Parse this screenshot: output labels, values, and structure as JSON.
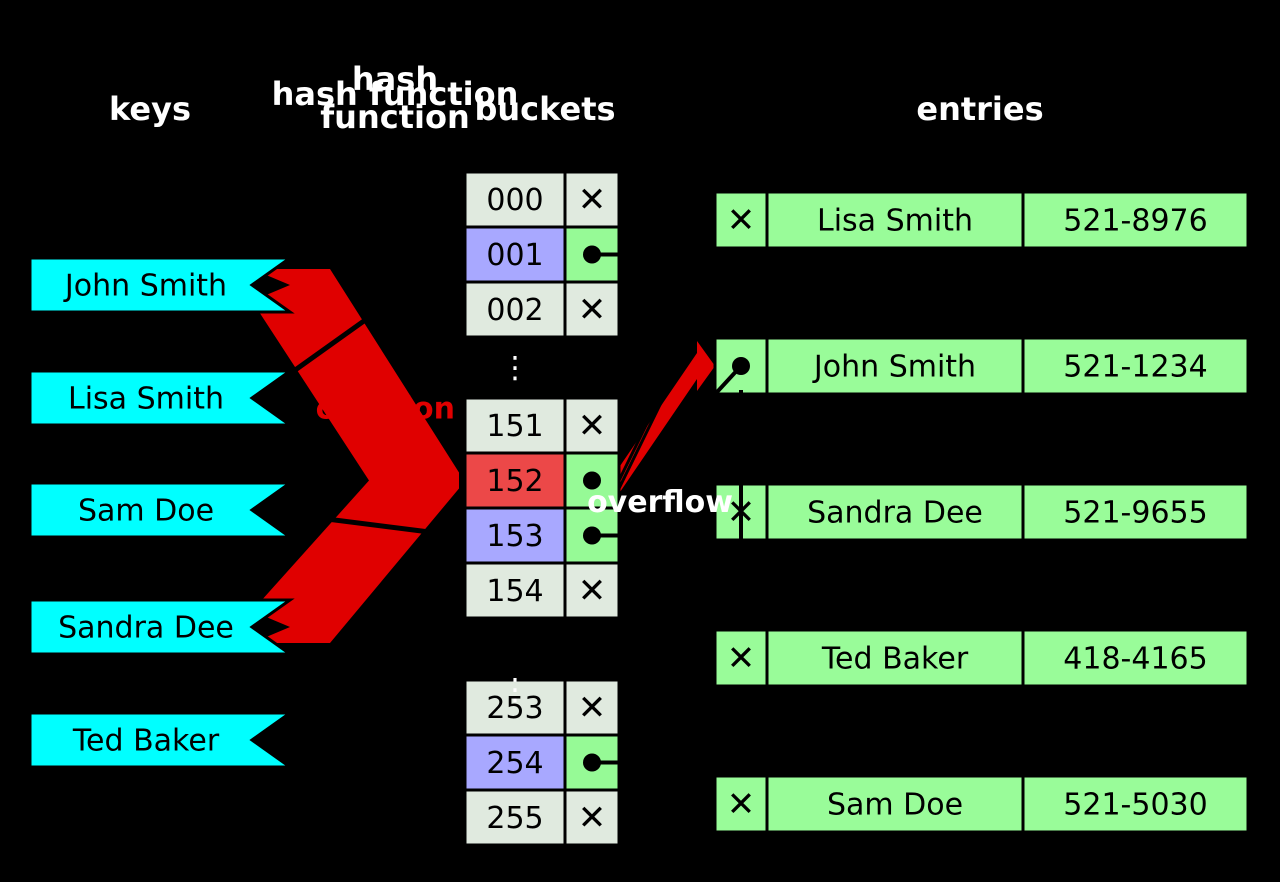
{
  "columns": {
    "keys": "keys",
    "hash": "hash function",
    "buckets": "buckets",
    "entries": "entries"
  },
  "collision_label": "collision",
  "overflow_label": "overflow",
  "keys": [
    {
      "name": "John Smith"
    },
    {
      "name": "Lisa Smith"
    },
    {
      "name": "Sam Doe"
    },
    {
      "name": "Sandra Dee"
    },
    {
      "name": "Ted Baker"
    }
  ],
  "buckets": {
    "group_a": [
      {
        "idx": "000",
        "fill": "empty"
      },
      {
        "idx": "001",
        "fill": "used"
      },
      {
        "idx": "002",
        "fill": "empty"
      }
    ],
    "group_b": [
      {
        "idx": "151",
        "fill": "empty"
      },
      {
        "idx": "152",
        "fill": "collision"
      },
      {
        "idx": "153",
        "fill": "used"
      },
      {
        "idx": "154",
        "fill": "empty"
      }
    ],
    "group_c": [
      {
        "idx": "253",
        "fill": "empty"
      },
      {
        "idx": "254",
        "fill": "used"
      },
      {
        "idx": "255",
        "fill": "empty"
      }
    ]
  },
  "entries": [
    {
      "prev": "end",
      "name": "Lisa Smith",
      "phone": "521-8976"
    },
    {
      "prev": "chain",
      "name": "John Smith",
      "phone": "521-1234"
    },
    {
      "prev": "end",
      "name": "Sandra Dee",
      "phone": "521-9655"
    },
    {
      "prev": "end",
      "name": "Ted Baker",
      "phone": "418-4165"
    },
    {
      "prev": "end",
      "name": "Sam Doe",
      "phone": "521-5030"
    }
  ],
  "colors": {
    "key": "#00ffff",
    "bucket_empty": "#e0eadf",
    "bucket_used": "#a8a8ff",
    "bucket_ptr": "#96fa96",
    "bucket_collision": "#ec4848",
    "entry": "#99fc99",
    "collision": "#e00000"
  },
  "vdots": "⋮"
}
